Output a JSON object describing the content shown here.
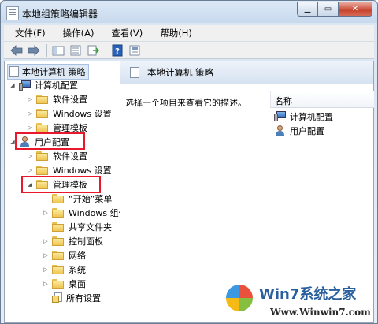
{
  "window": {
    "title": "本地组策略编辑器"
  },
  "caption_buttons": {
    "minimize": "▁",
    "maximize": "▭",
    "close": "✕"
  },
  "menu": [
    "文件(F)",
    "操作(A)",
    "查看(V)",
    "帮助(H)"
  ],
  "toolbar": [
    "back-icon",
    "forward-icon",
    "up-icon",
    "show-hide-tree-icon",
    "export-list-icon",
    "help-icon",
    "properties-icon"
  ],
  "tree": {
    "root": "本地计算机 策略",
    "computer_config": "计算机配置",
    "computer_children": [
      "软件设置",
      "Windows 设置",
      "管理模板"
    ],
    "user_config": "用户配置",
    "user_children": [
      "软件设置",
      "Windows 设置",
      "管理模板"
    ],
    "admin_templates_children": [
      "“开始”菜单",
      "Windows 组件",
      "共享文件夹",
      "控制面板",
      "网络",
      "系统",
      "桌面",
      "所有设置"
    ]
  },
  "right_pane": {
    "title": "本地计算机 策略",
    "description": "选择一个项目来查看它的描述。",
    "column_name": "名称",
    "items": [
      "计算机配置",
      "用户配置"
    ]
  },
  "watermark": {
    "title": "Win7系统之家",
    "url": "Www.Winwin7.com"
  },
  "colors": {
    "highlight_box": "#e8192c",
    "title_bar": "#c9daee"
  }
}
